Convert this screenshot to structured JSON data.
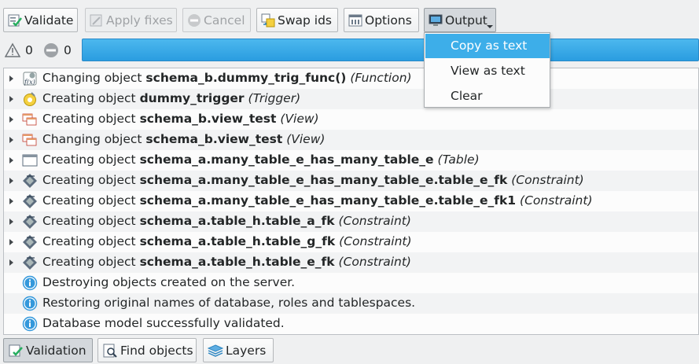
{
  "toolbar": {
    "validate": "Validate",
    "apply_fixes": "Apply fixes",
    "cancel": "Cancel",
    "swap_ids": "Swap ids",
    "options": "Options",
    "output": "Output"
  },
  "status": {
    "warnings": "0",
    "errors": "0",
    "progress": 1.0,
    "progress_color": "#3daee9"
  },
  "output_menu": {
    "items": [
      "Copy as text",
      "View as text",
      "Clear"
    ],
    "highlighted": "Copy as text"
  },
  "results": [
    {
      "action": "Changing object",
      "object": "schema_b.dummy_trig_func()",
      "type": "(Function)",
      "icon": "function-icon",
      "expandable": true
    },
    {
      "action": "Creating object",
      "object": "dummy_trigger",
      "type": "(Trigger)",
      "icon": "trigger-icon",
      "expandable": true
    },
    {
      "action": "Creating object",
      "object": "schema_b.view_test",
      "type": "(View)",
      "icon": "view-icon",
      "expandable": true
    },
    {
      "action": "Changing object",
      "object": "schema_b.view_test",
      "type": "(View)",
      "icon": "view-icon",
      "expandable": true
    },
    {
      "action": "Creating object",
      "object": "schema_a.many_table_e_has_many_table_e",
      "type": "(Table)",
      "icon": "table-icon",
      "expandable": true
    },
    {
      "action": "Creating object",
      "object": "schema_a.many_table_e_has_many_table_e.table_e_fk",
      "type": "(Constraint)",
      "icon": "constraint-icon",
      "expandable": true
    },
    {
      "action": "Creating object",
      "object": "schema_a.many_table_e_has_many_table_e.table_e_fk1",
      "type": "(Constraint)",
      "icon": "constraint-icon",
      "expandable": true
    },
    {
      "action": "Creating object",
      "object": "schema_a.table_h.table_a_fk",
      "type": "(Constraint)",
      "icon": "constraint-icon",
      "expandable": true
    },
    {
      "action": "Creating object",
      "object": "schema_a.table_h.table_g_fk",
      "type": "(Constraint)",
      "icon": "constraint-icon",
      "expandable": true
    },
    {
      "action": "Creating object",
      "object": "schema_a.table_h.table_e_fk",
      "type": "(Constraint)",
      "icon": "constraint-icon",
      "expandable": true
    }
  ],
  "messages": [
    "Destroying objects created on the server.",
    "Restoring original names of database, roles and tablespaces.",
    "Database model successfully validated."
  ],
  "tabs": {
    "validation": "Validation",
    "find_objects": "Find objects",
    "layers": "Layers"
  }
}
